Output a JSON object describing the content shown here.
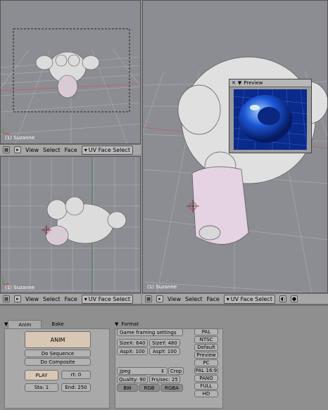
{
  "viewports": {
    "top_left": {
      "object_label": "(1) Suzanne"
    },
    "bottom_left": {
      "object_label": "(1) Suzanne"
    },
    "right": {
      "object_label": "(1) Suzanne"
    }
  },
  "header": {
    "view": "View",
    "select": "Select",
    "face": "Face",
    "mode": "UV Face Select"
  },
  "preview": {
    "title": "Preview"
  },
  "tabs": {
    "anim": "Anim",
    "bake": "Bake",
    "format": "Format"
  },
  "anim_panel": {
    "anim": "ANIM",
    "do_sequence": "Do Sequence",
    "do_composite": "Do Composite",
    "play": "PLAY",
    "rt": "rt: 0",
    "sta": "Sta: 1",
    "end": "End: 250"
  },
  "format_panel": {
    "game_framing": "Game framing settings",
    "sizex": "SizeX: 640",
    "sizey": "SizeY: 480",
    "aspx": "AspX: 100",
    "aspy": "AspY: 100",
    "format_select": "Jpeg",
    "crop": "Crop",
    "quality": "Quality: 90",
    "frs": "Frs/sec: 25",
    "bw": "BW",
    "rgb": "RGB",
    "rgba": "RGBA",
    "presets": [
      "PAL",
      "NTSC",
      "Default",
      "Preview",
      "PC",
      "PAL 16:9",
      "PANO",
      "FULL",
      "HD"
    ]
  }
}
